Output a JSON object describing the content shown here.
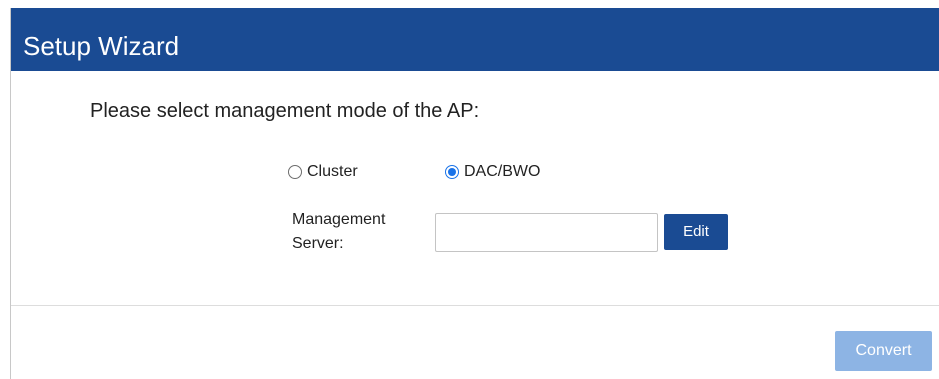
{
  "dialog": {
    "title": "Setup Wizard",
    "prompt": "Please select management mode of the AP:",
    "mode_options": [
      {
        "label": "Cluster",
        "checked": false
      },
      {
        "label": "DAC/BWO",
        "checked": true
      }
    ],
    "management_server": {
      "label_line1": "Management",
      "label_line2": "Server:",
      "value": "",
      "edit_label": "Edit"
    },
    "convert_label": "Convert",
    "convert_enabled": false
  },
  "colors": {
    "title_bar": "#1a4b93",
    "primary_button": "#1a4b93",
    "disabled_button": "#8db4e4",
    "radio_selected": "#1a73e8"
  }
}
